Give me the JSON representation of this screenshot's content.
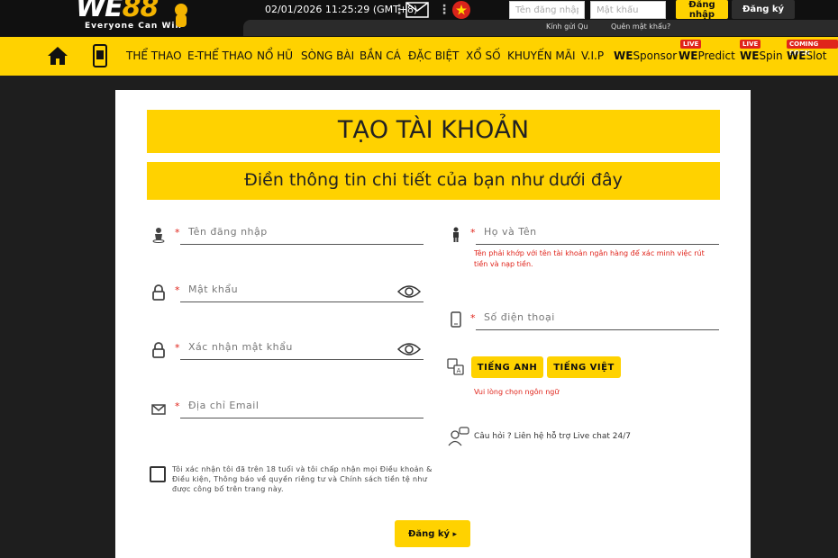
{
  "header": {
    "logo_word_a": "WE",
    "logo_word_b": "88",
    "logo_tagline": "Everyone Can Win",
    "datetime": "02/01/2026 11:25:29",
    "timezone": "(GMT+8)",
    "username_placeholder": "Tên đăng nhập",
    "password_placeholder": "Mật khẩu",
    "login_label": "Đăng nhập",
    "register_label": "Đăng ký",
    "ticker_text": "Kính gửi Qu",
    "forgot_label": "Quên mật khẩu?",
    "flag_color": "#d9241b"
  },
  "nav": {
    "items": [
      "THỂ THAO",
      "E-THỂ THAO",
      "NỔ HŨ",
      "SÒNG BÀI",
      "BẮN CÁ",
      "ĐẶC BIỆT",
      "XỔ SỐ",
      "KHUYẾN MÃI",
      "V.I.P"
    ],
    "we_prefix": "WE",
    "special": [
      {
        "suffix": "Sponsor",
        "badge": ""
      },
      {
        "suffix": "Predict",
        "badge": "LIVE"
      },
      {
        "suffix": "Spin",
        "badge": "LIVE"
      },
      {
        "suffix": "Slot",
        "badge": "COMING SOON"
      }
    ],
    "accent": "#ffd200"
  },
  "form": {
    "title": "TẠO TÀI KHOẢN",
    "subtitle": "Điền thông tin chi tiết của bạn như dưới đây",
    "required_mark": "*",
    "username_placeholder": "Tên đăng nhập",
    "password_placeholder": "Mật khẩu",
    "confirm_placeholder": "Xác nhận mật khẩu",
    "email_placeholder": "Địa chỉ Email",
    "fullname_placeholder": "Họ và Tên",
    "fullname_hint": "Tên phải khớp với tên tài khoản ngân hàng để xác minh việc rút tiền và nạp tiền.",
    "phone_placeholder": "Số điện thoại",
    "lang_en": "TIẾNG ANH",
    "lang_vi": "TIẾNG VIỆT",
    "lang_hint": "Vui lòng chọn ngôn ngữ",
    "support_text": "Câu hỏi ? Liên hệ hỗ trợ Live chat 24/7",
    "terms_text": "Tôi xác nhận tôi đã trên 18 tuổi và tôi chấp nhận mọi Điều khoản & Điều kiện, Thông báo về quyền riêng tư và Chính sách tiền tệ như được công bố trên trang này.",
    "submit_label": "Đăng ký",
    "submit_arrow": "▸",
    "error_color": "#e0241b"
  }
}
